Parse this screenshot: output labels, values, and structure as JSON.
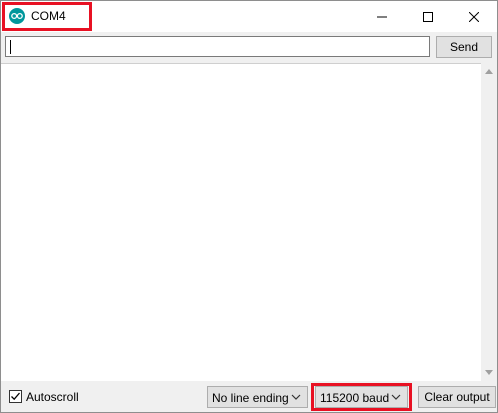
{
  "window": {
    "title": "COM4"
  },
  "colors": {
    "highlight": "#e81123",
    "app_icon": "#00979c"
  },
  "icons": {
    "app": "arduino-icon",
    "minimize": "minimize-icon",
    "maximize": "maximize-icon",
    "close": "close-icon"
  },
  "toolbar": {
    "input_value": "",
    "send_label": "Send"
  },
  "footer": {
    "autoscroll_label": "Autoscroll",
    "autoscroll_checked": true,
    "line_ending": "No line ending",
    "baud": "115200 baud",
    "clear_label": "Clear output"
  }
}
